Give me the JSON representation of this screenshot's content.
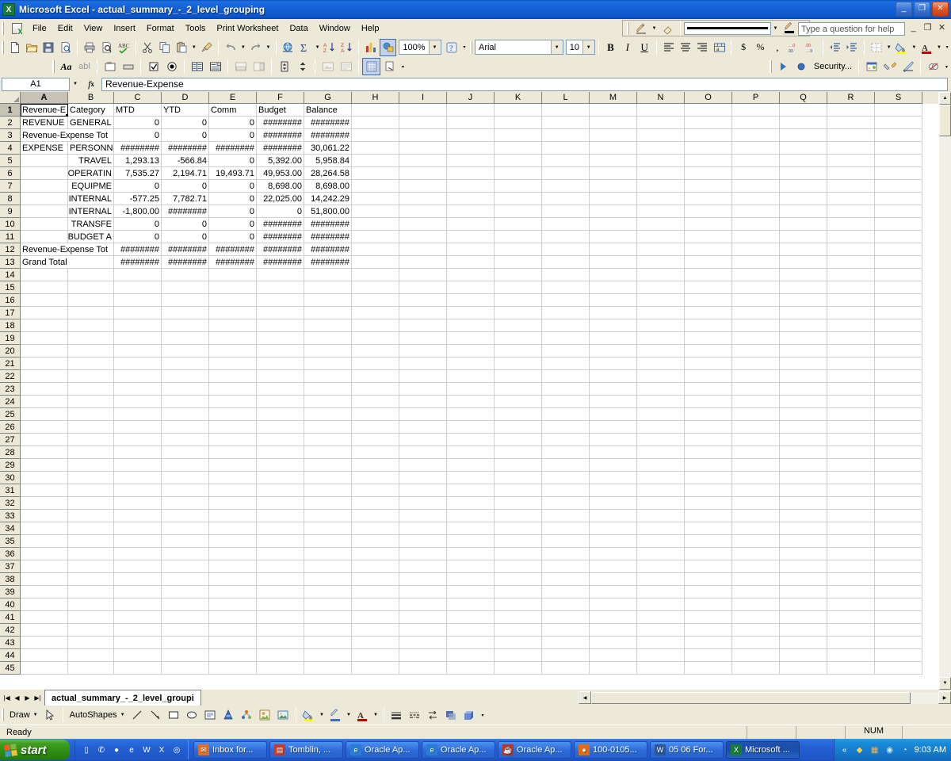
{
  "window": {
    "title": "Microsoft Excel - actual_summary_-_2_level_grouping",
    "app_icon": "excel-icon",
    "minimize": "_",
    "maximize": "❐",
    "close": "✕"
  },
  "menu": {
    "items": [
      {
        "label": "File"
      },
      {
        "label": "Edit"
      },
      {
        "label": "View"
      },
      {
        "label": "Insert"
      },
      {
        "label": "Format"
      },
      {
        "label": "Tools"
      },
      {
        "label": "Print Worksheet"
      },
      {
        "label": "Data"
      },
      {
        "label": "Window"
      },
      {
        "label": "Help"
      }
    ],
    "help_placeholder": "Type a question for help",
    "win_minimize": "_",
    "win_restore": "❐",
    "win_close": "✕"
  },
  "borders_toolbar": {
    "draw_border_icon": "pencil-border-icon",
    "erase_border_icon": "eraser-icon",
    "line_style_value": "",
    "line_color_icon": "line-color-icon"
  },
  "standard_toolbar": {
    "buttons": [
      {
        "name": "new-button",
        "icon": "new-document-icon"
      },
      {
        "name": "open-button",
        "icon": "open-folder-icon"
      },
      {
        "name": "save-button",
        "icon": "floppy-disk-icon"
      },
      {
        "name": "permission-button",
        "icon": "search-document-icon"
      },
      {
        "name": "print-button",
        "icon": "printer-icon"
      },
      {
        "name": "print-preview-button",
        "icon": "print-preview-icon"
      },
      {
        "name": "spelling-button",
        "icon": "spell-check-icon"
      },
      {
        "name": "cut-button",
        "icon": "scissors-icon"
      },
      {
        "name": "copy-button",
        "icon": "copy-icon"
      },
      {
        "name": "paste-button",
        "icon": "clipboard-paste-icon"
      },
      {
        "name": "format-painter-button",
        "icon": "paintbrush-icon"
      },
      {
        "name": "undo-button",
        "icon": "undo-arrow-icon"
      },
      {
        "name": "redo-button",
        "icon": "redo-arrow-icon"
      },
      {
        "name": "hyperlink-button",
        "icon": "globe-link-icon"
      },
      {
        "name": "autosum-button",
        "icon": "sigma-icon"
      },
      {
        "name": "sort-ascending-button",
        "icon": "sort-az-icon"
      },
      {
        "name": "sort-descending-button",
        "icon": "sort-za-icon"
      },
      {
        "name": "chart-wizard-button",
        "icon": "bar-chart-icon"
      },
      {
        "name": "drawing-button",
        "icon": "drawing-icon"
      }
    ],
    "zoom_value": "100%",
    "help_button_icon": "question-mark-icon"
  },
  "formatting_toolbar": {
    "font_name": "Arial",
    "font_size": "10",
    "bold": "B",
    "italic": "I",
    "underline": "U",
    "align_left_icon": "align-left-icon",
    "align_center_icon": "align-center-icon",
    "align_right_icon": "align-right-icon",
    "merge_center_icon": "merge-cells-icon",
    "currency": "$",
    "percent": "%",
    "comma": ",",
    "increase_decimal_icon": "increase-decimal-icon",
    "decrease_decimal_icon": "decrease-decimal-icon",
    "decrease_indent_icon": "decrease-indent-icon",
    "increase_indent_icon": "increase-indent-icon",
    "borders_icon": "borders-icon",
    "fill_color_icon": "fill-color-icon",
    "font_color_icon": "font-color-icon"
  },
  "controls_toolbar": {
    "buttons": [
      {
        "name": "font-control-button",
        "icon": "font-aa-icon"
      },
      {
        "name": "label-control-button",
        "icon": "label-abl-icon"
      },
      {
        "name": "textbox-control-button",
        "icon": "textbox-xyz-icon"
      },
      {
        "name": "command-button-control",
        "icon": "command-button-icon"
      },
      {
        "name": "checkbox-control-button",
        "icon": "checkbox-icon"
      },
      {
        "name": "option-button-control",
        "icon": "radio-button-icon"
      },
      {
        "name": "listbox-control-button",
        "icon": "listbox-icon"
      },
      {
        "name": "combobox-control-button",
        "icon": "combobox-icon"
      },
      {
        "name": "toggle-control-button",
        "icon": "toggle-button-icon"
      },
      {
        "name": "scrollbar-control-button",
        "icon": "scrollbar-icon"
      },
      {
        "name": "spinbutton-control-button",
        "icon": "spin-button-icon"
      },
      {
        "name": "image-control-button",
        "icon": "image-control-icon"
      },
      {
        "name": "more-controls-button",
        "icon": "more-controls-icon"
      },
      {
        "name": "design-mode-button",
        "icon": "design-grid-icon"
      },
      {
        "name": "properties-button",
        "icon": "properties-hand-icon"
      }
    ]
  },
  "visualbasic_toolbar": {
    "run_icon": "run-macro-icon",
    "security_icon": "security-shield-icon",
    "security_label": "Security...",
    "vb_editor_icon": "visual-basic-editor-icon",
    "control_toolbox_icon": "control-toolbox-icon",
    "design_mode_icon": "design-mode-icon",
    "microsoft_script_icon": "script-editor-icon"
  },
  "formula_bar": {
    "name_box": "A1",
    "fx_label": "fx",
    "formula": "Revenue-Expense"
  },
  "grid": {
    "columns": [
      {
        "letter": "A",
        "width": 60,
        "selected": true
      },
      {
        "letter": "B",
        "width": 58,
        "selected": false
      },
      {
        "letter": "C",
        "width": 60,
        "selected": false
      },
      {
        "letter": "D",
        "width": 60,
        "selected": false
      },
      {
        "letter": "E",
        "width": 60,
        "selected": false
      },
      {
        "letter": "F",
        "width": 60,
        "selected": false
      },
      {
        "letter": "G",
        "width": 60,
        "selected": false
      },
      {
        "letter": "H",
        "width": 60,
        "selected": false
      },
      {
        "letter": "I",
        "width": 60,
        "selected": false
      },
      {
        "letter": "J",
        "width": 60,
        "selected": false
      },
      {
        "letter": "K",
        "width": 60,
        "selected": false
      },
      {
        "letter": "L",
        "width": 60,
        "selected": false
      },
      {
        "letter": "M",
        "width": 60,
        "selected": false
      },
      {
        "letter": "N",
        "width": 60,
        "selected": false
      },
      {
        "letter": "O",
        "width": 60,
        "selected": false
      },
      {
        "letter": "P",
        "width": 60,
        "selected": false
      },
      {
        "letter": "Q",
        "width": 60,
        "selected": false
      },
      {
        "letter": "R",
        "width": 60,
        "selected": false
      },
      {
        "letter": "S",
        "width": 60,
        "selected": false
      }
    ],
    "total_rows": 45,
    "active_cell": "A1",
    "rows": [
      {
        "n": 1,
        "cells": [
          {
            "v": "Revenue-E",
            "a": "l",
            "active": true
          },
          {
            "v": "Category",
            "a": "l"
          },
          {
            "v": "MTD",
            "a": "l"
          },
          {
            "v": "YTD",
            "a": "l"
          },
          {
            "v": "Comm",
            "a": "l"
          },
          {
            "v": "Budget",
            "a": "l"
          },
          {
            "v": "Balance",
            "a": "l"
          }
        ]
      },
      {
        "n": 2,
        "cells": [
          {
            "v": "REVENUE",
            "a": "l"
          },
          {
            "v": "GENERAL",
            "a": "l"
          },
          {
            "v": "0",
            "a": "r"
          },
          {
            "v": "0",
            "a": "r"
          },
          {
            "v": "0",
            "a": "r"
          },
          {
            "v": "########",
            "a": "r"
          },
          {
            "v": "########",
            "a": "r"
          }
        ]
      },
      {
        "n": 3,
        "cells": [
          {
            "v": "Revenue-Expense Tot",
            "a": "l",
            "span": 2
          },
          {
            "v": "0",
            "a": "r"
          },
          {
            "v": "0",
            "a": "r"
          },
          {
            "v": "0",
            "a": "r"
          },
          {
            "v": "########",
            "a": "r"
          },
          {
            "v": "########",
            "a": "r"
          }
        ]
      },
      {
        "n": 4,
        "cells": [
          {
            "v": "EXPENSE",
            "a": "l"
          },
          {
            "v": "PERSONN",
            "a": "l"
          },
          {
            "v": "########",
            "a": "r"
          },
          {
            "v": "########",
            "a": "r"
          },
          {
            "v": "########",
            "a": "r"
          },
          {
            "v": "########",
            "a": "r"
          },
          {
            "v": "30,061.22",
            "a": "r"
          }
        ]
      },
      {
        "n": 5,
        "cells": [
          {
            "v": "",
            "a": "l"
          },
          {
            "v": "TRAVEL",
            "a": "r"
          },
          {
            "v": "1,293.13",
            "a": "r"
          },
          {
            "v": "-566.84",
            "a": "r"
          },
          {
            "v": "0",
            "a": "r"
          },
          {
            "v": "5,392.00",
            "a": "r"
          },
          {
            "v": "5,958.84",
            "a": "r"
          }
        ]
      },
      {
        "n": 6,
        "cells": [
          {
            "v": "",
            "a": "l"
          },
          {
            "v": "OPERATIN",
            "a": "r"
          },
          {
            "v": "7,535.27",
            "a": "r"
          },
          {
            "v": "2,194.71",
            "a": "r"
          },
          {
            "v": "19,493.71",
            "a": "r"
          },
          {
            "v": "49,953.00",
            "a": "r"
          },
          {
            "v": "28,264.58",
            "a": "r"
          }
        ]
      },
      {
        "n": 7,
        "cells": [
          {
            "v": "",
            "a": "l"
          },
          {
            "v": "EQUIPME",
            "a": "r"
          },
          {
            "v": "0",
            "a": "r"
          },
          {
            "v": "0",
            "a": "r"
          },
          {
            "v": "0",
            "a": "r"
          },
          {
            "v": "8,698.00",
            "a": "r"
          },
          {
            "v": "8,698.00",
            "a": "r"
          }
        ]
      },
      {
        "n": 8,
        "cells": [
          {
            "v": "",
            "a": "l"
          },
          {
            "v": "INTERNAL",
            "a": "r"
          },
          {
            "v": "-577.25",
            "a": "r"
          },
          {
            "v": "7,782.71",
            "a": "r"
          },
          {
            "v": "0",
            "a": "r"
          },
          {
            "v": "22,025.00",
            "a": "r"
          },
          {
            "v": "14,242.29",
            "a": "r"
          }
        ]
      },
      {
        "n": 9,
        "cells": [
          {
            "v": "",
            "a": "l"
          },
          {
            "v": "INTERNAL",
            "a": "r"
          },
          {
            "v": "-1,800.00",
            "a": "r"
          },
          {
            "v": "########",
            "a": "r"
          },
          {
            "v": "0",
            "a": "r"
          },
          {
            "v": "0",
            "a": "r"
          },
          {
            "v": "51,800.00",
            "a": "r"
          }
        ]
      },
      {
        "n": 10,
        "cells": [
          {
            "v": "",
            "a": "l"
          },
          {
            "v": "TRANSFE",
            "a": "r"
          },
          {
            "v": "0",
            "a": "r"
          },
          {
            "v": "0",
            "a": "r"
          },
          {
            "v": "0",
            "a": "r"
          },
          {
            "v": "########",
            "a": "r"
          },
          {
            "v": "########",
            "a": "r"
          }
        ]
      },
      {
        "n": 11,
        "cells": [
          {
            "v": "",
            "a": "l"
          },
          {
            "v": "BUDGET A",
            "a": "r"
          },
          {
            "v": "0",
            "a": "r"
          },
          {
            "v": "0",
            "a": "r"
          },
          {
            "v": "0",
            "a": "r"
          },
          {
            "v": "########",
            "a": "r"
          },
          {
            "v": "########",
            "a": "r"
          }
        ]
      },
      {
        "n": 12,
        "cells": [
          {
            "v": "Revenue-Expense Tot",
            "a": "l",
            "span": 2
          },
          {
            "v": "########",
            "a": "r"
          },
          {
            "v": "########",
            "a": "r"
          },
          {
            "v": "########",
            "a": "r"
          },
          {
            "v": "########",
            "a": "r"
          },
          {
            "v": "########",
            "a": "r"
          }
        ]
      },
      {
        "n": 13,
        "cells": [
          {
            "v": "Grand Total",
            "a": "l",
            "span": 2
          },
          {
            "v": "########",
            "a": "r"
          },
          {
            "v": "########",
            "a": "r"
          },
          {
            "v": "########",
            "a": "r"
          },
          {
            "v": "########",
            "a": "r"
          },
          {
            "v": "########",
            "a": "r"
          }
        ]
      }
    ]
  },
  "sheet_tabs": {
    "first_icon": "first-sheet-icon",
    "prev_icon": "prev-sheet-icon",
    "next_icon": "next-sheet-icon",
    "last_icon": "last-sheet-icon",
    "tabs": [
      {
        "label": "actual_summary_-_2_level_groupi",
        "active": true
      }
    ]
  },
  "drawing_toolbar": {
    "draw_label": "Draw",
    "select_icon": "arrow-select-icon",
    "autoshapes_label": "AutoShapes",
    "line_icon": "line-icon",
    "arrow_icon": "arrow-icon",
    "rectangle_icon": "rectangle-icon",
    "oval_icon": "oval-icon",
    "textbox_icon": "text-box-icon",
    "wordart_icon": "wordart-icon",
    "diagram_icon": "diagram-icon",
    "clipart_icon": "clip-art-icon",
    "picture_icon": "insert-picture-icon",
    "fill_color_icon": "fill-color-icon",
    "line_color_icon": "line-color-icon",
    "font_color_icon": "font-color-icon",
    "line_style_icon": "line-style-icon",
    "dash_style_icon": "dash-style-icon",
    "arrow_style_icon": "arrow-style-icon",
    "shadow_style_icon": "shadow-style-icon",
    "three_d_style_icon": "3d-style-icon"
  },
  "status_bar": {
    "mode": "Ready",
    "num_lock": "NUM"
  },
  "taskbar": {
    "start_label": "start",
    "quick_launch": [
      {
        "name": "quicklaunch-show-desktop",
        "icon": "show-desktop-icon",
        "glyph": "▯"
      },
      {
        "name": "quicklaunch-messenger",
        "icon": "messenger-icon",
        "glyph": "✆"
      },
      {
        "name": "quicklaunch-firefox",
        "icon": "firefox-icon",
        "glyph": "●"
      },
      {
        "name": "quicklaunch-internet-explorer",
        "icon": "internet-explorer-icon",
        "glyph": "e"
      },
      {
        "name": "quicklaunch-word",
        "icon": "word-icon",
        "glyph": "W"
      },
      {
        "name": "quicklaunch-excel",
        "icon": "excel-icon",
        "glyph": "X"
      },
      {
        "name": "quicklaunch-outlook",
        "icon": "outlook-icon",
        "glyph": "◎"
      }
    ],
    "tasks": [
      {
        "label": "Inbox for...",
        "icon": "outlook-icon",
        "glyph": "✉",
        "color": "#d9712a",
        "active": false
      },
      {
        "label": "Tomblin, ...",
        "icon": "document-icon",
        "glyph": "▤",
        "color": "#c23b2f",
        "active": false
      },
      {
        "label": "Oracle Ap...",
        "icon": "internet-explorer-icon",
        "glyph": "e",
        "color": "#2a7bd4",
        "active": false
      },
      {
        "label": "Oracle Ap...",
        "icon": "internet-explorer-icon",
        "glyph": "e",
        "color": "#2a7bd4",
        "active": false
      },
      {
        "label": "Oracle Ap...",
        "icon": "java-icon",
        "glyph": "☕",
        "color": "#b03a2e",
        "active": false
      },
      {
        "label": "100-0105...",
        "icon": "firefox-icon",
        "glyph": "●",
        "color": "#e06a1a",
        "active": false
      },
      {
        "label": "05 06 For...",
        "icon": "word-icon",
        "glyph": "W",
        "color": "#2b579a",
        "active": false
      },
      {
        "label": "Microsoft ...",
        "icon": "excel-icon",
        "glyph": "X",
        "color": "#1a7a3a",
        "active": true
      }
    ],
    "tray_icons": [
      {
        "name": "show-hidden-icons",
        "glyph": "«"
      },
      {
        "name": "antivirus-icon",
        "glyph": "🛡"
      },
      {
        "name": "network-icon",
        "glyph": "▞"
      },
      {
        "name": "shield-icon",
        "glyph": "⛨"
      },
      {
        "name": "volume-icon",
        "glyph": "◔"
      }
    ],
    "clock": "9:03 AM"
  }
}
